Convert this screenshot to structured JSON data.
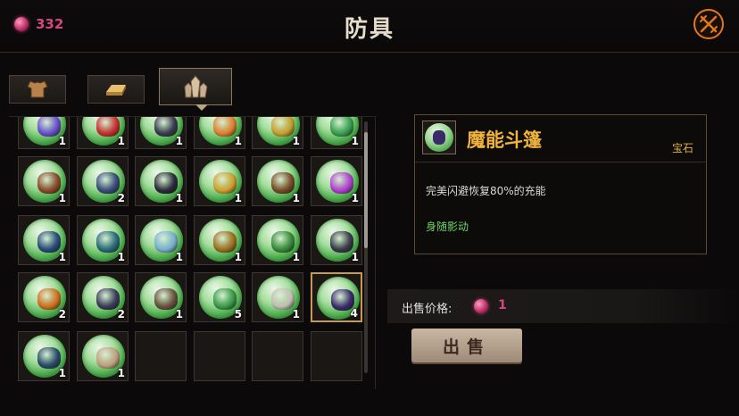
{
  "header": {
    "title": "防具",
    "currency_value": "332",
    "currency_icon": "pink-gem-icon",
    "close_icon": "crossed-swords-icon"
  },
  "tabs": [
    {
      "icon": "chest-armor-icon",
      "active": false
    },
    {
      "icon": "ingot-bar-icon",
      "active": false
    },
    {
      "icon": "crystal-cluster-icon",
      "active": true
    }
  ],
  "inventory": {
    "rows": [
      [
        {
          "count": "1",
          "color": "#6a4fd0"
        },
        {
          "count": "1",
          "color": "#c83030"
        },
        {
          "count": "1",
          "color": "#3a3a50"
        },
        {
          "count": "1",
          "color": "#e08030"
        },
        {
          "count": "1",
          "color": "#c8a030"
        },
        {
          "count": "1",
          "color": "#3aa050"
        }
      ],
      [
        {
          "count": "1",
          "color": "#8a4a2a"
        },
        {
          "count": "2",
          "color": "#3a4a7a"
        },
        {
          "count": "1",
          "color": "#2a2a3a"
        },
        {
          "count": "1",
          "color": "#d0a030"
        },
        {
          "count": "1",
          "color": "#7a4a2a"
        },
        {
          "count": "1",
          "color": "#b040d0"
        }
      ],
      [
        {
          "count": "1",
          "color": "#2a4a7a"
        },
        {
          "count": "1",
          "color": "#2a6a7a"
        },
        {
          "count": "1",
          "color": "#7ab0d0"
        },
        {
          "count": "1",
          "color": "#a07020"
        },
        {
          "count": "1",
          "color": "#3a8a3a"
        },
        {
          "count": "1",
          "color": "#3a3a4a"
        }
      ],
      [
        {
          "count": "2",
          "color": "#d07020"
        },
        {
          "count": "2",
          "color": "#3a3a5a"
        },
        {
          "count": "1",
          "color": "#6a5040"
        },
        {
          "count": "5",
          "color": "#3a9a4a"
        },
        {
          "count": "1",
          "color": "#c0c0b0"
        },
        {
          "count": "4",
          "color": "#3a2a6a",
          "selected": true
        }
      ],
      [
        {
          "count": "1",
          "color": "#2a4a6a"
        },
        {
          "count": "1",
          "color": "#c0a080"
        },
        {
          "empty": true
        },
        {
          "empty": true
        },
        {
          "empty": true
        },
        {
          "empty": true
        }
      ]
    ]
  },
  "detail": {
    "name": "魔能斗篷",
    "type": "宝石",
    "description": "完美闪避恢复80%的充能",
    "set_name": "身随影动",
    "icon_color": "#3a2a6a"
  },
  "sell": {
    "price_label": "出售价格:",
    "price_value": "1",
    "button_label": "出售"
  },
  "colors": {
    "accent_gold": "#f0b43a",
    "price_pink": "#d8467e",
    "set_green": "#6fd06a"
  }
}
